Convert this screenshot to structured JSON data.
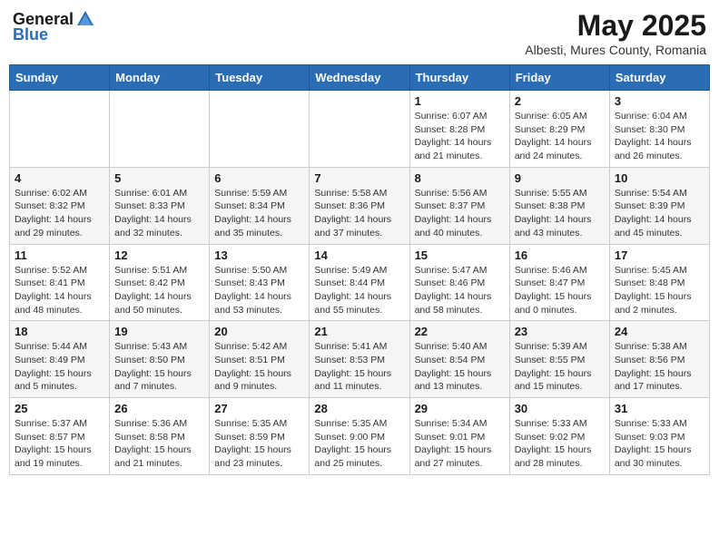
{
  "header": {
    "logo_general": "General",
    "logo_blue": "Blue",
    "title": "May 2025",
    "subtitle": "Albesti, Mures County, Romania"
  },
  "days_of_week": [
    "Sunday",
    "Monday",
    "Tuesday",
    "Wednesday",
    "Thursday",
    "Friday",
    "Saturday"
  ],
  "weeks": [
    [
      {
        "day": "",
        "info": ""
      },
      {
        "day": "",
        "info": ""
      },
      {
        "day": "",
        "info": ""
      },
      {
        "day": "",
        "info": ""
      },
      {
        "day": "1",
        "info": "Sunrise: 6:07 AM\nSunset: 8:28 PM\nDaylight: 14 hours\nand 21 minutes."
      },
      {
        "day": "2",
        "info": "Sunrise: 6:05 AM\nSunset: 8:29 PM\nDaylight: 14 hours\nand 24 minutes."
      },
      {
        "day": "3",
        "info": "Sunrise: 6:04 AM\nSunset: 8:30 PM\nDaylight: 14 hours\nand 26 minutes."
      }
    ],
    [
      {
        "day": "4",
        "info": "Sunrise: 6:02 AM\nSunset: 8:32 PM\nDaylight: 14 hours\nand 29 minutes."
      },
      {
        "day": "5",
        "info": "Sunrise: 6:01 AM\nSunset: 8:33 PM\nDaylight: 14 hours\nand 32 minutes."
      },
      {
        "day": "6",
        "info": "Sunrise: 5:59 AM\nSunset: 8:34 PM\nDaylight: 14 hours\nand 35 minutes."
      },
      {
        "day": "7",
        "info": "Sunrise: 5:58 AM\nSunset: 8:36 PM\nDaylight: 14 hours\nand 37 minutes."
      },
      {
        "day": "8",
        "info": "Sunrise: 5:56 AM\nSunset: 8:37 PM\nDaylight: 14 hours\nand 40 minutes."
      },
      {
        "day": "9",
        "info": "Sunrise: 5:55 AM\nSunset: 8:38 PM\nDaylight: 14 hours\nand 43 minutes."
      },
      {
        "day": "10",
        "info": "Sunrise: 5:54 AM\nSunset: 8:39 PM\nDaylight: 14 hours\nand 45 minutes."
      }
    ],
    [
      {
        "day": "11",
        "info": "Sunrise: 5:52 AM\nSunset: 8:41 PM\nDaylight: 14 hours\nand 48 minutes."
      },
      {
        "day": "12",
        "info": "Sunrise: 5:51 AM\nSunset: 8:42 PM\nDaylight: 14 hours\nand 50 minutes."
      },
      {
        "day": "13",
        "info": "Sunrise: 5:50 AM\nSunset: 8:43 PM\nDaylight: 14 hours\nand 53 minutes."
      },
      {
        "day": "14",
        "info": "Sunrise: 5:49 AM\nSunset: 8:44 PM\nDaylight: 14 hours\nand 55 minutes."
      },
      {
        "day": "15",
        "info": "Sunrise: 5:47 AM\nSunset: 8:46 PM\nDaylight: 14 hours\nand 58 minutes."
      },
      {
        "day": "16",
        "info": "Sunrise: 5:46 AM\nSunset: 8:47 PM\nDaylight: 15 hours\nand 0 minutes."
      },
      {
        "day": "17",
        "info": "Sunrise: 5:45 AM\nSunset: 8:48 PM\nDaylight: 15 hours\nand 2 minutes."
      }
    ],
    [
      {
        "day": "18",
        "info": "Sunrise: 5:44 AM\nSunset: 8:49 PM\nDaylight: 15 hours\nand 5 minutes."
      },
      {
        "day": "19",
        "info": "Sunrise: 5:43 AM\nSunset: 8:50 PM\nDaylight: 15 hours\nand 7 minutes."
      },
      {
        "day": "20",
        "info": "Sunrise: 5:42 AM\nSunset: 8:51 PM\nDaylight: 15 hours\nand 9 minutes."
      },
      {
        "day": "21",
        "info": "Sunrise: 5:41 AM\nSunset: 8:53 PM\nDaylight: 15 hours\nand 11 minutes."
      },
      {
        "day": "22",
        "info": "Sunrise: 5:40 AM\nSunset: 8:54 PM\nDaylight: 15 hours\nand 13 minutes."
      },
      {
        "day": "23",
        "info": "Sunrise: 5:39 AM\nSunset: 8:55 PM\nDaylight: 15 hours\nand 15 minutes."
      },
      {
        "day": "24",
        "info": "Sunrise: 5:38 AM\nSunset: 8:56 PM\nDaylight: 15 hours\nand 17 minutes."
      }
    ],
    [
      {
        "day": "25",
        "info": "Sunrise: 5:37 AM\nSunset: 8:57 PM\nDaylight: 15 hours\nand 19 minutes."
      },
      {
        "day": "26",
        "info": "Sunrise: 5:36 AM\nSunset: 8:58 PM\nDaylight: 15 hours\nand 21 minutes."
      },
      {
        "day": "27",
        "info": "Sunrise: 5:35 AM\nSunset: 8:59 PM\nDaylight: 15 hours\nand 23 minutes."
      },
      {
        "day": "28",
        "info": "Sunrise: 5:35 AM\nSunset: 9:00 PM\nDaylight: 15 hours\nand 25 minutes."
      },
      {
        "day": "29",
        "info": "Sunrise: 5:34 AM\nSunset: 9:01 PM\nDaylight: 15 hours\nand 27 minutes."
      },
      {
        "day": "30",
        "info": "Sunrise: 5:33 AM\nSunset: 9:02 PM\nDaylight: 15 hours\nand 28 minutes."
      },
      {
        "day": "31",
        "info": "Sunrise: 5:33 AM\nSunset: 9:03 PM\nDaylight: 15 hours\nand 30 minutes."
      }
    ]
  ]
}
